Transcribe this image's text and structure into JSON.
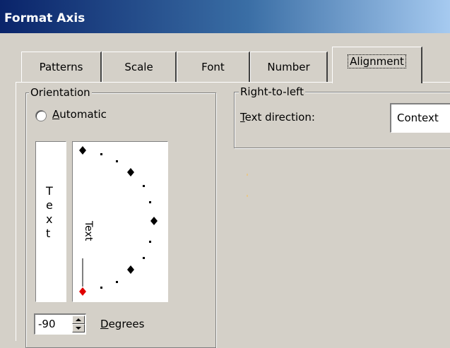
{
  "window": {
    "title": "Format Axis"
  },
  "tabs": [
    {
      "label": "Patterns"
    },
    {
      "label": "Scale"
    },
    {
      "label": "Font"
    },
    {
      "label": "Number"
    },
    {
      "label": "Alignment"
    }
  ],
  "orientation": {
    "legend": "Orientation",
    "automatic_label_pre": "",
    "automatic_label_u": "A",
    "automatic_label_post": "utomatic",
    "text_vertical": [
      "T",
      "e",
      "x",
      "t"
    ],
    "dial_text": "Text",
    "degrees_value": "-90",
    "degrees_label_u": "D",
    "degrees_label_post": "egrees"
  },
  "rtl": {
    "legend": "Right-to-left",
    "direction_label_u": "T",
    "direction_label_post": "ext direction:",
    "direction_value": "Context"
  }
}
